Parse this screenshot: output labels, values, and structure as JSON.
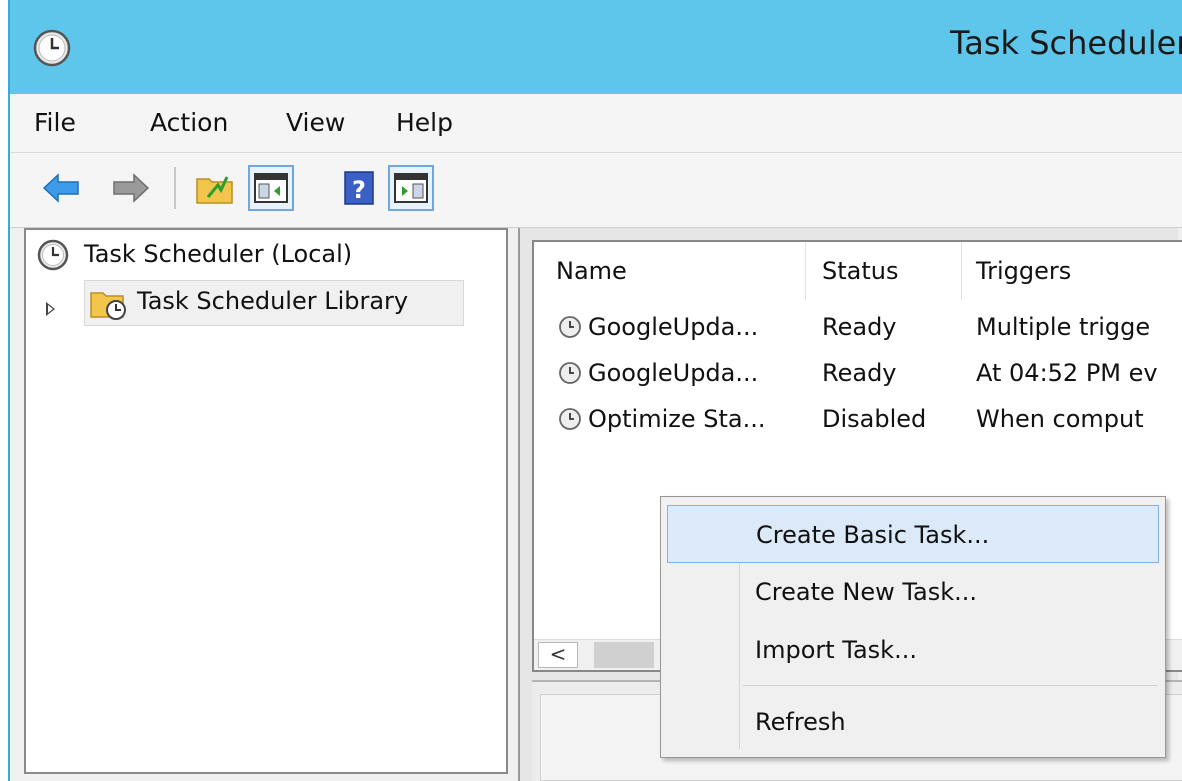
{
  "window": {
    "title": "Task Scheduler"
  },
  "menu": [
    "File",
    "Action",
    "View",
    "Help"
  ],
  "toolbar": {
    "buttons": [
      "back-arrow-icon",
      "forward-arrow-icon",
      "up-folder-icon",
      "show-hide-console-tree-icon",
      "help-icon",
      "show-hide-action-pane-icon"
    ]
  },
  "tree": {
    "root": "Task Scheduler (Local)",
    "child": "Task Scheduler Library"
  },
  "task_list": {
    "columns": [
      "Name",
      "Status",
      "Triggers"
    ],
    "rows": [
      {
        "name": "GoogleUpda...",
        "status": "Ready",
        "triggers": "Multiple trigge"
      },
      {
        "name": "GoogleUpda...",
        "status": "Ready",
        "triggers": "At 04:52 PM ev"
      },
      {
        "name": "Optimize Sta...",
        "status": "Disabled",
        "triggers": "When comput"
      }
    ],
    "scroll_left": "<"
  },
  "context_menu": {
    "items": [
      "Create Basic Task...",
      "Create New Task...",
      "Import Task...",
      "Refresh"
    ]
  },
  "colors": {
    "titlebar": "#5ec6ea",
    "highlight": "#dbe9f8",
    "highlight_border": "#7fb3e6"
  }
}
